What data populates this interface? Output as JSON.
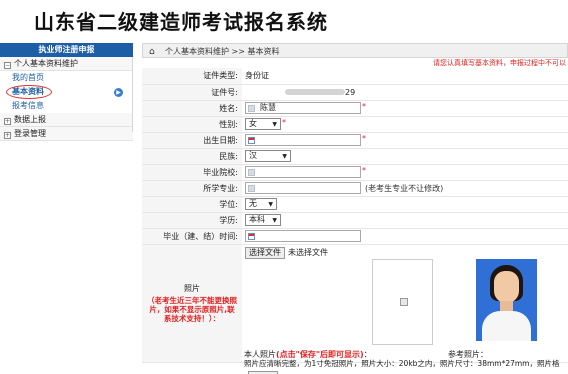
{
  "header": {
    "title": "山东省二级建造师考试报名系统"
  },
  "sidebar": {
    "head": "执业师注册申报",
    "groups": [
      {
        "label": "个人基本资料维护",
        "toggle": "−"
      },
      {
        "label": "数据上报",
        "toggle": "+"
      },
      {
        "label": "登录管理",
        "toggle": "+"
      }
    ],
    "sub_items": [
      {
        "label": "我的首页"
      },
      {
        "label": "基本资料",
        "active": true
      },
      {
        "label": "报考信息"
      }
    ]
  },
  "breadcrumb": "个人基本资料维护 >> 基本资料",
  "notice": "请您认真填写基本资料，申报过程中不可以",
  "form": {
    "id_type": {
      "label": "证件类型:",
      "value": "身份证"
    },
    "id_number": {
      "label": "证件号:",
      "value": "29"
    },
    "name": {
      "label": "姓名:",
      "value": "陈慧"
    },
    "gender": {
      "label": "性别:",
      "value": "女"
    },
    "birth": {
      "label": "出生日期:",
      "value": ""
    },
    "ethnicity": {
      "label": "民族:",
      "value": "汉"
    },
    "school": {
      "label": "毕业院校:",
      "value": ""
    },
    "major": {
      "label": "所学专业:",
      "value": "",
      "hint": "(老考生专业不让修改)"
    },
    "degree": {
      "label": "学位:",
      "value": "无"
    },
    "education": {
      "label": "学历:",
      "value": "本科"
    },
    "grad_time": {
      "label": "毕业（建、结）时间:",
      "value": ""
    }
  },
  "photo": {
    "label": "照片",
    "warning": "（老考生近三年不能更换照片，如果不显示原照片,联系技术支持！）：",
    "file_button": "选择文件",
    "file_status": "未选择文件",
    "caption_prefix": "本人照片",
    "caption_red": "(点击\"保存\"后即可显示)",
    "caption_colon": "：",
    "ref_label": "参考照片：",
    "requirement": "照片应清晰完整，为1寸免冠照片，照片大小：20kb之内，照片尺寸：38mm*27mm，照片格"
  },
  "colors": {
    "accent": "#1d5fa6",
    "required": "#e02020"
  },
  "required_marker": "*"
}
